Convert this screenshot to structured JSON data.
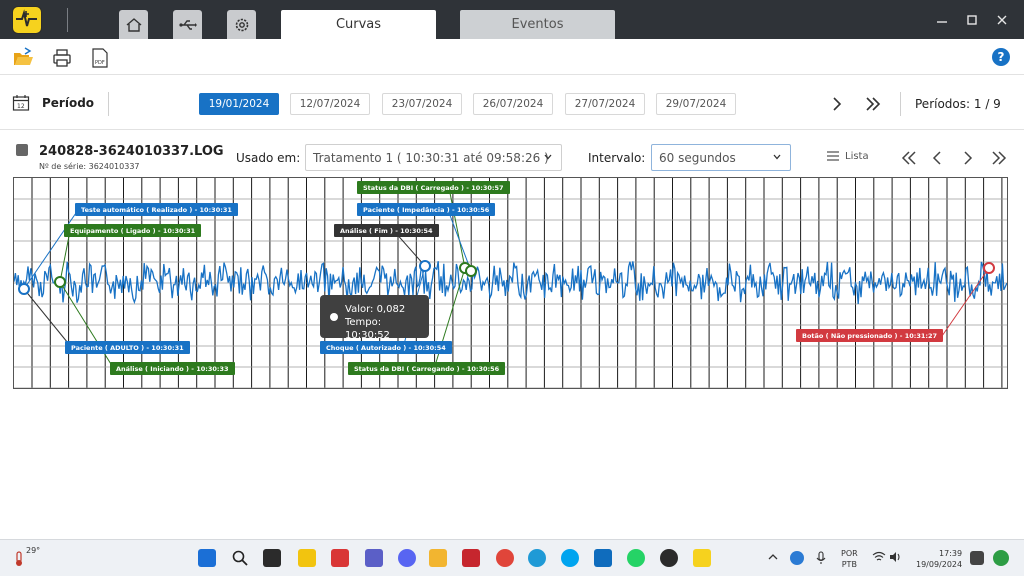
{
  "window": {
    "tabs": [
      {
        "label": "Curvas",
        "active": true
      },
      {
        "label": "Eventos",
        "active": false
      }
    ],
    "nav_icons": [
      "home-icon",
      "usb-icon",
      "gear-icon"
    ],
    "controls": [
      "minimize",
      "maximize",
      "close"
    ]
  },
  "toolbar": {
    "icons": [
      "open-folder-icon",
      "print-icon",
      "pdf-icon"
    ],
    "help_label": "?"
  },
  "period": {
    "label": "Período",
    "dates": [
      "19/01/2024",
      "12/07/2024",
      "23/07/2024",
      "26/07/2024",
      "27/07/2024",
      "29/07/2024"
    ],
    "active_index": 0,
    "counter": "Períodos: 1 / 9"
  },
  "file": {
    "name": "240828-3624010337.LOG",
    "serial": "Nº de série: 3624010337",
    "used_label": "Usado em:",
    "used_value": "Tratamento 1 ( 10:30:31 até 09:58:26 )",
    "interval_label": "Intervalo:",
    "interval_value": "60 segundos",
    "list_label": "Lista"
  },
  "chart_data": {
    "type": "line",
    "title": "",
    "xlabel": "",
    "ylabel": "",
    "grid": true,
    "colors": {
      "signal": "#1872c5",
      "grid": "#1a1a1a"
    },
    "events": [
      {
        "label": "Teste automático ( Realizado ) - 10:30:31",
        "color": "#1872c5"
      },
      {
        "label": "Equipamento ( Ligado ) - 10:30:31",
        "color": "#2d7a1e"
      },
      {
        "label": "Paciente ( ADULTO ) - 10:30:31",
        "color": "#1872c5"
      },
      {
        "label": "Análise ( Iniciando ) - 10:30:33",
        "color": "#2d7a1e"
      },
      {
        "label": "Status da DBI ( Carregado ) - 10:30:57",
        "color": "#2d7a1e"
      },
      {
        "label": "Paciente ( Impedância ) - 10:30:56",
        "color": "#1872c5"
      },
      {
        "label": "Análise ( Fim ) - 10:30:54",
        "color": "#333333"
      },
      {
        "label": "Choque ( Autorizado ) - 10:30:54",
        "color": "#1872c5"
      },
      {
        "label": "Status da DBI ( Carregando ) - 10:30:56",
        "color": "#2d7a1e"
      },
      {
        "label": "Botão ( Não pressionado ) - 10:31:27",
        "color": "#d23a40"
      }
    ],
    "tooltip": {
      "value_label": "Valor: 0,082",
      "time_label": "Tempo: 10:30:52"
    }
  },
  "taskbar": {
    "weather": "29°",
    "lang_line1": "POR",
    "lang_line2": "PTB",
    "time": "17:39",
    "date": "19/09/2024"
  }
}
